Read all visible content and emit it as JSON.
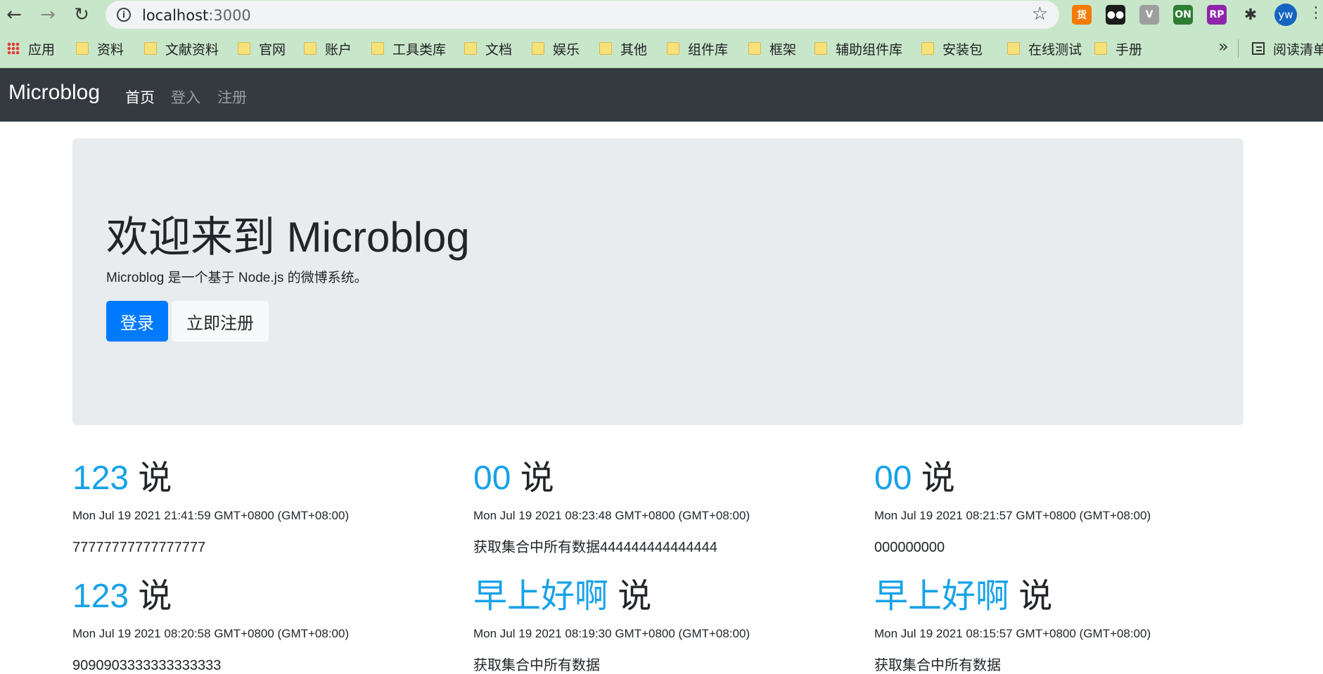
{
  "browser": {
    "back_glyph": "←",
    "forward_glyph": "→",
    "reload_glyph": "↻",
    "url_host": "localhost",
    "url_port": ":3000",
    "star_glyph": "☆",
    "extensions": [
      {
        "icon": "taobao-extension-icon",
        "label": "货",
        "color": "#f57c00"
      },
      {
        "icon": "tampermonkey-extension-icon",
        "label": "●●",
        "color": "#1b1b1b"
      },
      {
        "icon": "vue-devtools-extension-icon",
        "label": "V",
        "color": "#9e9e9e"
      },
      {
        "icon": "on-extension-icon",
        "label": "ON",
        "color": "#2e7d32"
      },
      {
        "icon": "axure-rp-extension-icon",
        "label": "RP",
        "color": "#8e24aa"
      },
      {
        "icon": "puzzle-extensions-icon",
        "label": "✱",
        "color": "#333333"
      }
    ],
    "avatar_text": "yw",
    "menu_glyph": "⋮"
  },
  "bookmarks": {
    "apps": "应用",
    "items": [
      "资料",
      "文献资料",
      "官网",
      "账户",
      "工具类库",
      "文档",
      "娱乐",
      "其他",
      "组件库",
      "框架",
      "辅助组件库",
      "安装包",
      "在线测试",
      "手册"
    ],
    "more": "»",
    "reading_list": "阅读清单"
  },
  "navbar": {
    "brand": "Microblog",
    "links": [
      "首页",
      "登入",
      "注册"
    ]
  },
  "jumbotron": {
    "title": "欢迎来到 Microblog",
    "lead": "Microblog 是一个基于 Node.js 的微博系统。",
    "login_button": "登录",
    "register_button": "立即注册"
  },
  "posts": [
    {
      "user": "123",
      "says": " 说",
      "time": "Mon Jul 19 2021 21:41:59 GMT+0800 (GMT+08:00)",
      "text": "77777777777777777"
    },
    {
      "user": "00",
      "says": " 说",
      "time": "Mon Jul 19 2021 08:23:48 GMT+0800 (GMT+08:00)",
      "text": "获取集合中所有数据444444444444444"
    },
    {
      "user": "00",
      "says": " 说",
      "time": "Mon Jul 19 2021 08:21:57 GMT+0800 (GMT+08:00)",
      "text": "000000000"
    },
    {
      "user": "123",
      "says": " 说",
      "time": "Mon Jul 19 2021 08:20:58 GMT+0800 (GMT+08:00)",
      "text": "9090903333333333333"
    },
    {
      "user": "早上好啊",
      "says": " 说",
      "time": "Mon Jul 19 2021 08:19:30 GMT+0800 (GMT+08:00)",
      "text": "获取集合中所有数据"
    },
    {
      "user": "早上好啊",
      "says": " 说",
      "time": "Mon Jul 19 2021 08:15:57 GMT+0800 (GMT+08:00)",
      "text": "获取集合中所有数据"
    }
  ]
}
